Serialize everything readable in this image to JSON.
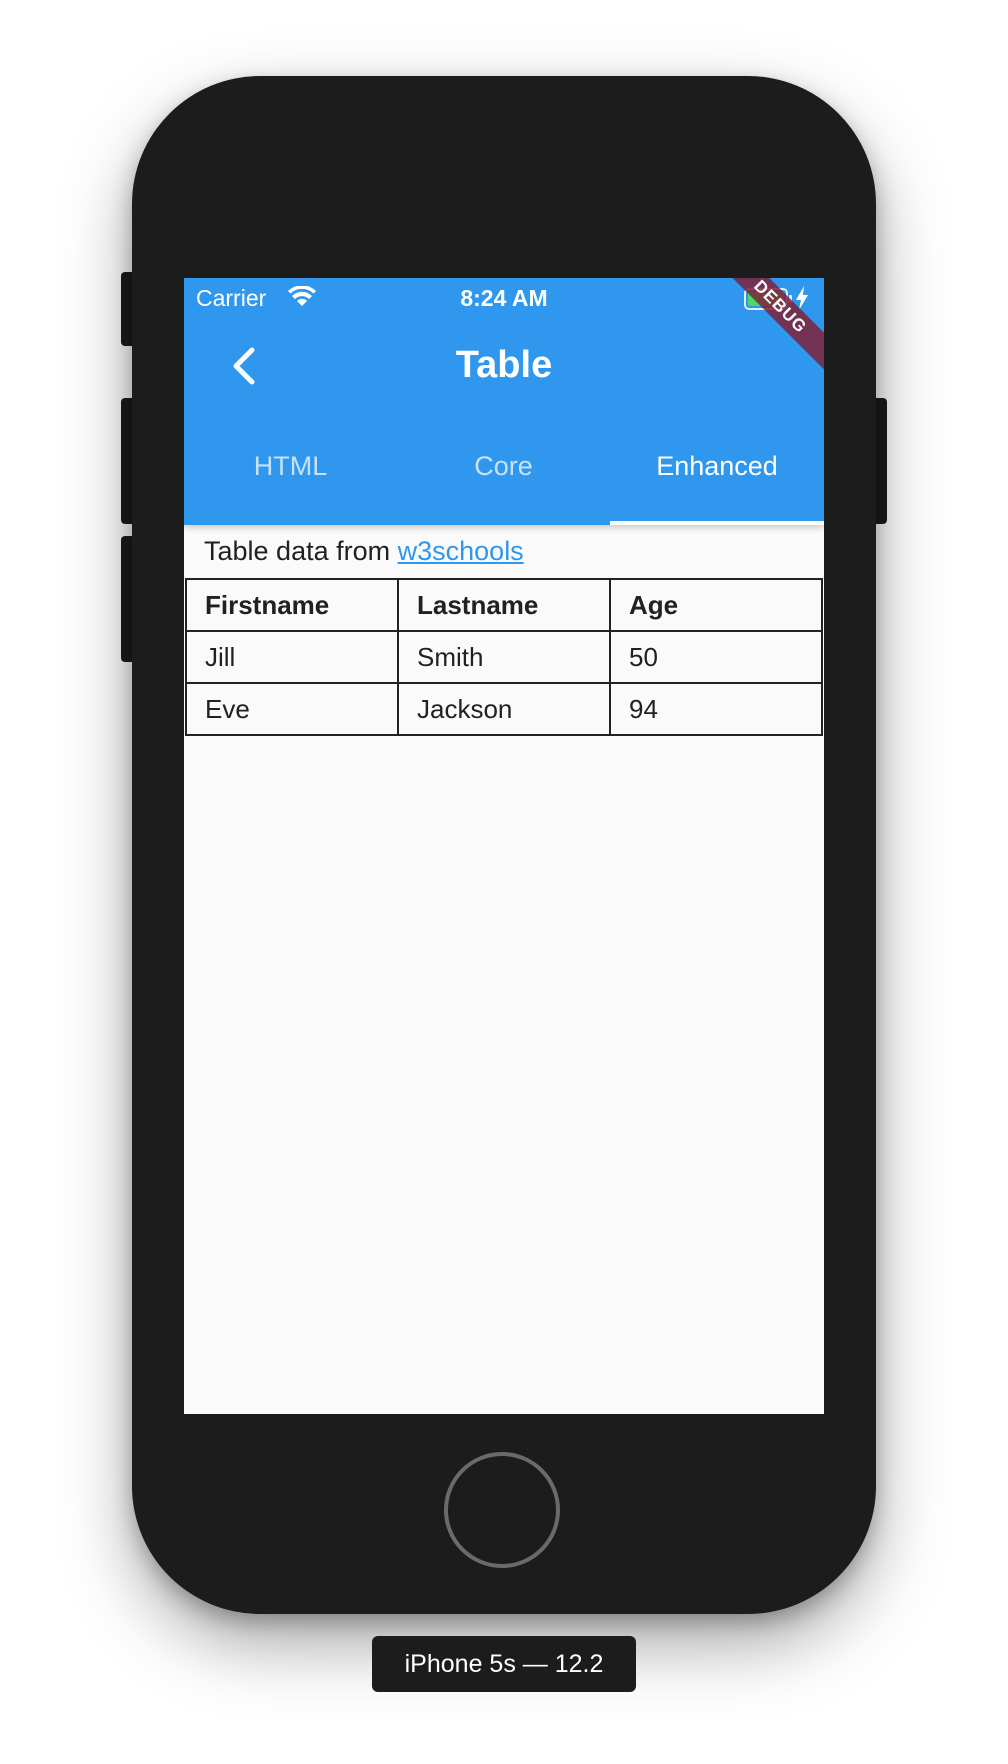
{
  "status_bar": {
    "carrier": "Carrier",
    "time": "8:24 AM",
    "wifi_icon": "wifi-icon",
    "battery_icon": "battery-icon",
    "charging_icon": "bolt-icon"
  },
  "app_bar": {
    "title": "Table",
    "back_icon": "chevron-left-icon",
    "color": "#2f97ee"
  },
  "debug_banner": "DEBUG",
  "tabs": [
    {
      "label": "HTML",
      "active": false
    },
    {
      "label": "Core",
      "active": false
    },
    {
      "label": "Enhanced",
      "active": true
    }
  ],
  "content": {
    "source_prefix": "Table data from",
    "source_link": "w3schools",
    "link_color": "#2f97ee"
  },
  "table": {
    "headers": [
      "Firstname",
      "Lastname",
      "Age"
    ],
    "rows": [
      [
        "Jill",
        "Smith",
        "50"
      ],
      [
        "Eve",
        "Jackson",
        "94"
      ]
    ]
  },
  "device": {
    "label": "iPhone 5s — 12.2"
  }
}
